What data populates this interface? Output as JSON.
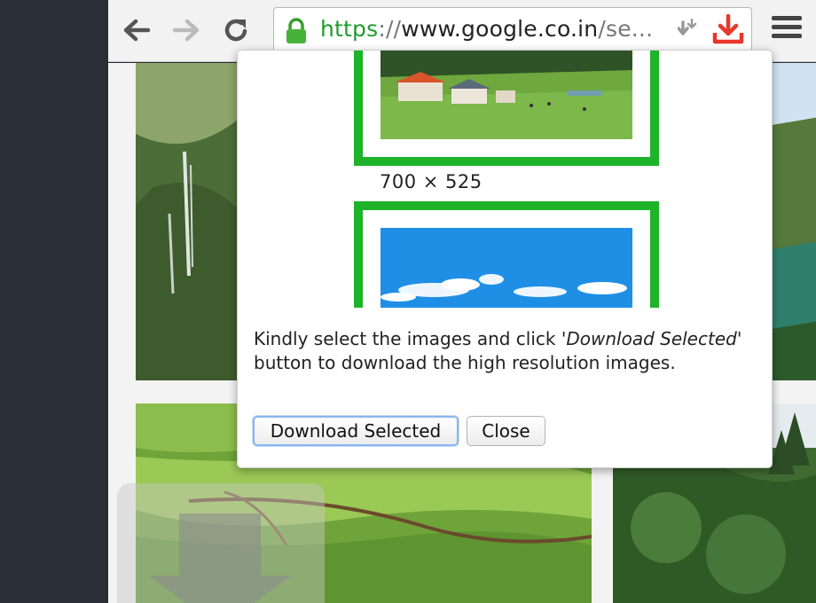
{
  "browser": {
    "url_scheme": "https",
    "url_sep": "://",
    "url_host": "www.google.co.in",
    "url_path": "/se...",
    "back_icon": "arrow-left-icon",
    "forward_icon": "arrow-right-icon",
    "reload_icon": "reload-icon",
    "lock_icon": "lock-icon",
    "menu_icon": "hamburger-icon"
  },
  "popup": {
    "size_label": "700 × 525",
    "message_part1": "Kindly select the images and click ",
    "message_emph": "'Download Selected'",
    "message_part2": " button to download the high resolution images.",
    "download_button": "Download Selected",
    "close_button": "Close"
  },
  "colors": {
    "selection_border": "#1eb32a",
    "secure_green": "#1f9b2e",
    "download_red": "#e8372c"
  }
}
